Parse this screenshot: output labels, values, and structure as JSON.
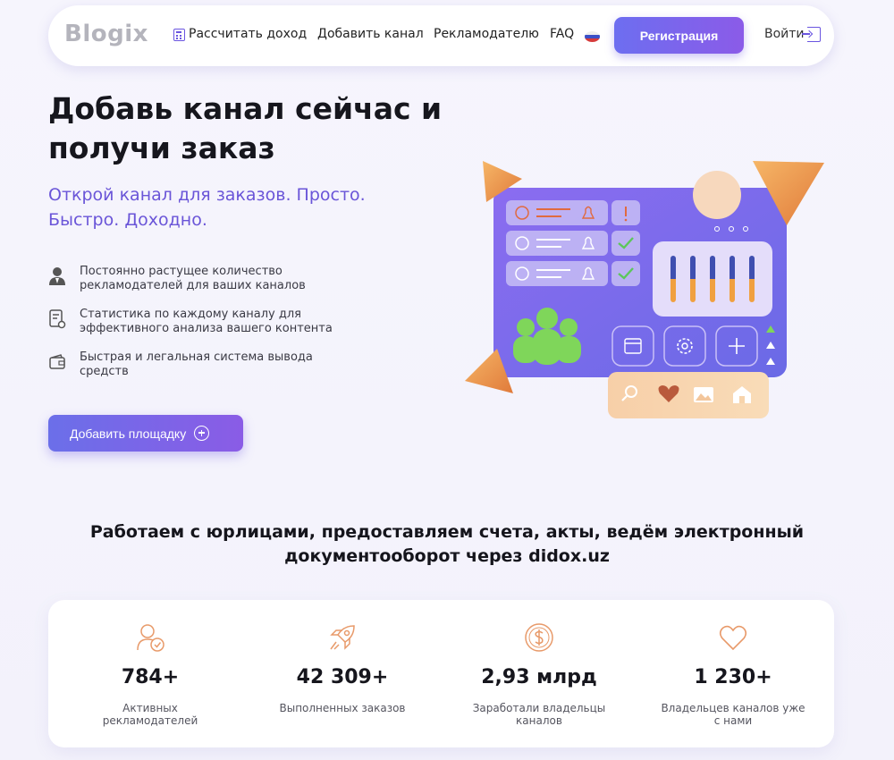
{
  "header": {
    "logo": "Blogix",
    "nav": {
      "calculate": "Рассчитать доход",
      "add_channel": "Добавить канал",
      "advertiser": "Рекламодателю",
      "faq": "FAQ"
    },
    "register_label": "Регистрация",
    "login_label": "Войти"
  },
  "hero": {
    "title": "Добавь канал сейчас и получи заказ",
    "subtitle": "Открой канал для заказов. Просто. Быстро. Доходно.",
    "features": [
      {
        "icon": "user-icon",
        "text": "Постоянно растущее количество рекламодателей для ваших каналов"
      },
      {
        "icon": "document-stats-icon",
        "text": "Статистика по каждому каналу для эффективного анализа вашего контента"
      },
      {
        "icon": "wallet-icon",
        "text": "Быстрая и легальная система вывода средств"
      }
    ],
    "cta_label": "Добавить площадку"
  },
  "legal_note": "Работаем с юрлицами, предоставляем счета, акты, ведём электронный документооборот через didox.uz",
  "stats": [
    {
      "icon": "user-check-icon",
      "value": "784+",
      "label": "Активных рекламодателей"
    },
    {
      "icon": "rocket-icon",
      "value": "42 309+",
      "label": "Выполненных заказов"
    },
    {
      "icon": "dollar-icon",
      "value": "2,93 млрд",
      "label": "Заработали владельцы каналов"
    },
    {
      "icon": "heart-icon",
      "value": "1 230+",
      "label": "Владельцев каналов уже с нами"
    }
  ],
  "colors": {
    "accent": "#6d6ef0",
    "accent2": "#8b5be8",
    "subtitle": "#6a55d8",
    "stat_icon": "#e89a6a",
    "logo": "#b4b4bc"
  }
}
